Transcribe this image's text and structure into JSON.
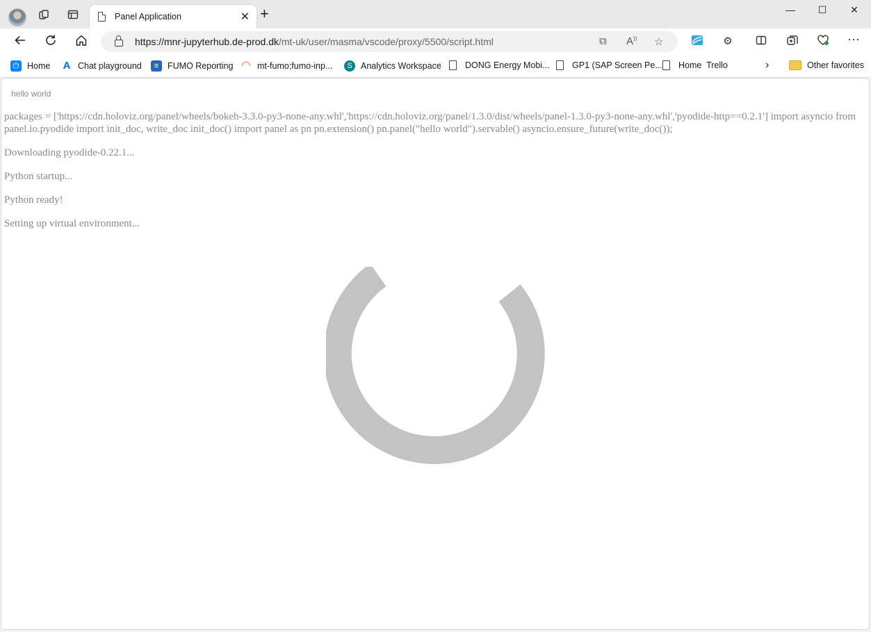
{
  "tab": {
    "title": "Panel Application"
  },
  "address": {
    "url_host": "https://mnr-jupyterhub.de-prod.dk",
    "url_path": "/mt-uk/user/masma/vscode/proxy/5500/script.html"
  },
  "favorites": [
    {
      "label": "Home",
      "icon": "power-icon",
      "color": "#0a84ff"
    },
    {
      "label": "Chat playground",
      "icon": "azure-icon",
      "color": "#0a6fd6"
    },
    {
      "label": "FUMO Reporting",
      "icon": "report-icon",
      "color": "#2b67b0"
    },
    {
      "label": "mt-fumo;fumo-inp...",
      "icon": "jupyter-icon",
      "color": "#f37726"
    },
    {
      "label": "Analytics Workspace",
      "icon": "sharepoint-icon",
      "color": "#038387"
    },
    {
      "label": "DONG Energy Mobi...",
      "icon": "page-icon"
    },
    {
      "label": "GP1 (SAP Screen Pe...",
      "icon": "page-icon"
    },
    {
      "label": "Home  Trello",
      "icon": "page-icon"
    }
  ],
  "other_favorites": "Other favorites",
  "page": {
    "panel_text": "hello world",
    "log": [
      "packages = ['https://cdn.holoviz.org/panel/wheels/bokeh-3.3.0-py3-none-any.whl','https://cdn.holoviz.org/panel/1.3.0/dist/wheels/panel-1.3.0-py3-none-any.whl','pyodide-http==0.2.1'] import asyncio from panel.io.pyodide import init_doc, write_doc init_doc() import panel as pn pn.extension() pn.panel(\"hello world\").servable() asyncio.ensure_future(write_doc());",
      "Downloading pyodide-0.22.1...",
      "Python startup...",
      "Python ready!",
      "Setting up virtual environment..."
    ]
  },
  "colors": {
    "spinner": "#c3c3c3",
    "log_text": "#8a8a8a"
  }
}
